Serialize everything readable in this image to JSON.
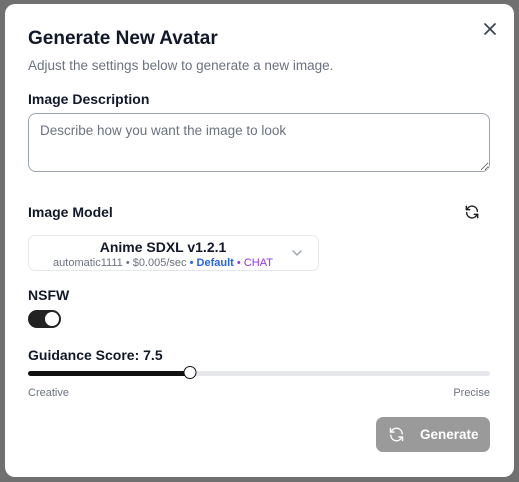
{
  "dialog": {
    "title": "Generate New Avatar",
    "subtitle": "Adjust the settings below to generate a new image.",
    "close_icon": "close-icon"
  },
  "description": {
    "label": "Image Description",
    "value": "",
    "placeholder": "Describe how you want the image to look"
  },
  "model": {
    "label": "Image Model",
    "refresh_icon": "refresh-icon",
    "selected_name": "Anime SDXL v1.2.1",
    "provider": "automatic1111",
    "separator": "•",
    "price": "$0.005/sec",
    "default_tag": "Default",
    "chat_tag": "CHAT",
    "chevron_icon": "chevron-down-icon"
  },
  "nsfw": {
    "label": "NSFW",
    "enabled": true
  },
  "guidance": {
    "label": "Guidance Score: 7.5",
    "value": 7.5,
    "min_label": "Creative",
    "max_label": "Precise",
    "fill_fraction": 0.35
  },
  "actions": {
    "generate_label": "Generate",
    "generate_icon": "refresh-icon"
  },
  "colors": {
    "accent_dark": "#111111",
    "default_tag": "#2563eb",
    "chat_tag": "#9333ea",
    "generate_button": "#9a9a9a"
  }
}
